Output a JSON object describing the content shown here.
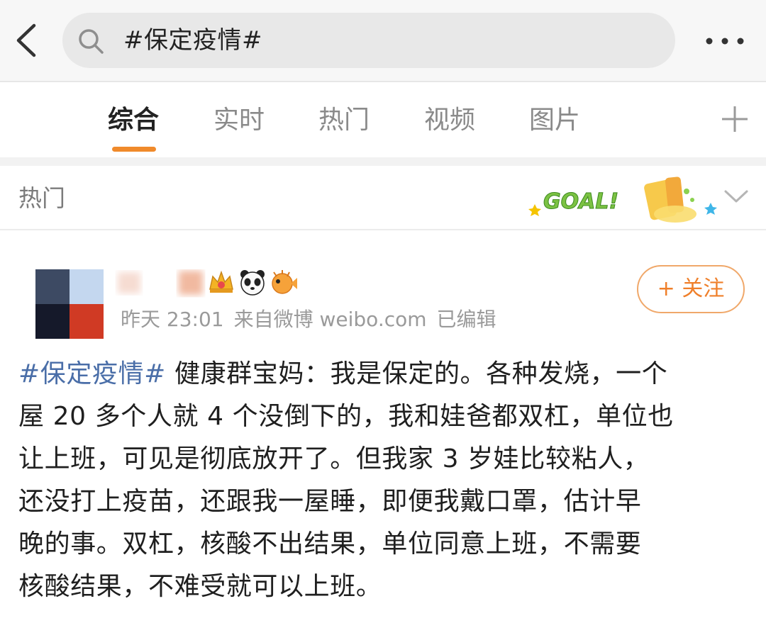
{
  "search": {
    "query": "#保定疫情#"
  },
  "tabs": [
    {
      "label": "综合",
      "active": true
    },
    {
      "label": "实时",
      "active": false
    },
    {
      "label": "热门",
      "active": false
    },
    {
      "label": "视频",
      "active": false
    },
    {
      "label": "图片",
      "active": false
    }
  ],
  "section": {
    "label": "热门",
    "badge_text": "GOAL!"
  },
  "post": {
    "time": "昨天 23:01",
    "source": "来自微博 weibo.com",
    "edited": "已编辑",
    "follow_label": "+ 关注",
    "hashtag": "#保定疫情#",
    "lines": [
      " 健康群宝妈：我是保定的。各种发烧，一个",
      "屋 20 多个人就 4 个没倒下的，我和娃爸都双杠，单位也",
      "让上班，可见是彻底放开了。但我家 3 岁娃比较粘人，",
      "还没打上疫苗，还跟我一屋睡，即便我戴口罩，估计早",
      "晚的事。双杠，核酸不出结果，单位同意上班，不需要",
      "核酸结果，不难受就可以上班。"
    ]
  },
  "colors": {
    "accent": "#f08a2b",
    "hashtag": "#4a6ea8",
    "muted": "#9a9a9a",
    "follow_border": "#f0a86a"
  },
  "icons": [
    "back-arrow-icon",
    "search-icon",
    "more-icon",
    "plus-icon",
    "chevron-down-icon",
    "crown-icon",
    "panda-icon",
    "pufferfish-icon"
  ]
}
